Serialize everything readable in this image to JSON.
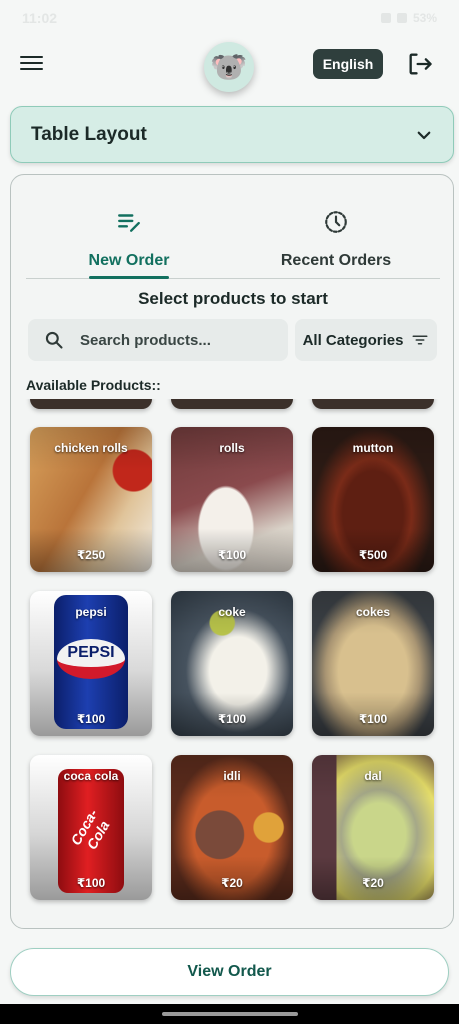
{
  "status_bar": {
    "time": "11:02",
    "battery": "53%"
  },
  "header": {
    "language_label": "English"
  },
  "table_layout": {
    "title": "Table Layout"
  },
  "tabs": [
    {
      "label": "New Order",
      "active": true
    },
    {
      "label": "Recent Orders",
      "active": false
    }
  ],
  "main": {
    "select_title": "Select products to start",
    "search_placeholder": "Search products...",
    "category_label": "All Categories",
    "available_label": "Available Products::"
  },
  "products": [
    {
      "name": "chicken rolls",
      "price": "₹250"
    },
    {
      "name": "rolls",
      "price": "₹100"
    },
    {
      "name": "mutton",
      "price": "₹500"
    },
    {
      "name": "pepsi",
      "price": "₹100"
    },
    {
      "name": "coke",
      "price": "₹100"
    },
    {
      "name": "cokes",
      "price": "₹100"
    },
    {
      "name": "coca cola",
      "price": "₹100"
    },
    {
      "name": "idli",
      "price": "₹20"
    },
    {
      "name": "dal",
      "price": "₹20"
    }
  ],
  "footer": {
    "view_order_label": "View Order"
  },
  "colors": {
    "accent": "#12705f",
    "banner_bg": "#d6ede6",
    "lang_btn": "#2f3f3d"
  }
}
